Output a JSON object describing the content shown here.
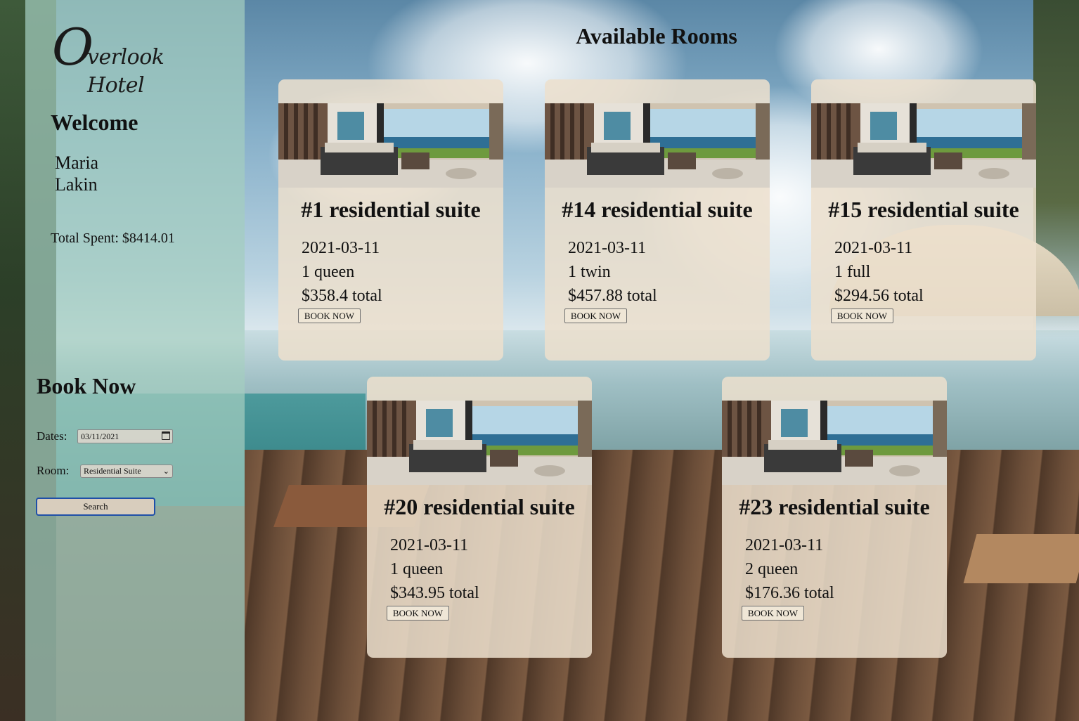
{
  "sidebar": {
    "logo": {
      "initial": "O",
      "rest": "verlook Hotel"
    },
    "welcome_title": "Welcome",
    "user_first": "Maria",
    "user_last": "Lakin",
    "total_spent": "Total Spent: $8414.01",
    "book": {
      "title": "Book Now",
      "dates_label": "Dates:",
      "date_value": "03/11/2021",
      "room_label": "Room:",
      "room_value": "Residential Suite",
      "search_label": "Search"
    }
  },
  "main": {
    "title": "Available Rooms",
    "rooms": [
      {
        "name": "#1 residential suite",
        "date": "2021-03-11",
        "beds": "1 queen",
        "total": "$358.4 total",
        "button": "BOOK NOW"
      },
      {
        "name": "#14 residential suite",
        "date": "2021-03-11",
        "beds": "1 twin",
        "total": "$457.88 total",
        "button": "BOOK NOW"
      },
      {
        "name": "#15 residential suite",
        "date": "2021-03-11",
        "beds": "1 full",
        "total": "$294.56 total",
        "button": "BOOK NOW"
      },
      {
        "name": "#20 residential suite",
        "date": "2021-03-11",
        "beds": "1 queen",
        "total": "$343.95 total",
        "button": "BOOK NOW"
      },
      {
        "name": "#23 residential suite",
        "date": "2021-03-11",
        "beds": "2 queen",
        "total": "$176.36 total",
        "button": "BOOK NOW"
      }
    ]
  },
  "colors": {
    "sidebar_tint": "#a3cdbf",
    "card_bg": "#ece0cd",
    "search_focus_border": "#1f4fa8"
  },
  "icons": {
    "date_picker": "calendar-icon",
    "select": "chevron-down-icon"
  }
}
